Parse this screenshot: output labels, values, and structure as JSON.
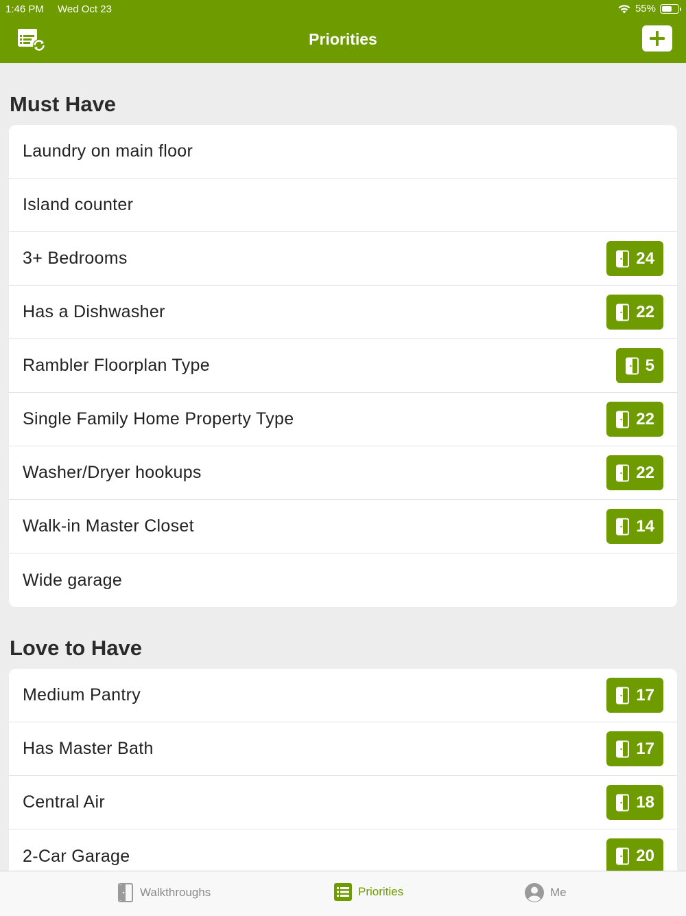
{
  "status_bar": {
    "time": "1:46 PM",
    "date": "Wed Oct 23",
    "battery": "55%",
    "battery_level": 0.55,
    "icons": [
      "wifi-icon",
      "battery-icon"
    ]
  },
  "header": {
    "title": "Priorities",
    "left_icon": "list-sync-icon",
    "right_icon": "plus-icon"
  },
  "sections": {
    "must_have": {
      "title": "Must Have",
      "items": [
        {
          "label": "Laundry on main floor",
          "count": ""
        },
        {
          "label": "Island counter",
          "count": ""
        },
        {
          "label": "3+ Bedrooms",
          "count": "24"
        },
        {
          "label": "Has a Dishwasher",
          "count": "22"
        },
        {
          "label": "Rambler Floorplan Type",
          "count": "5"
        },
        {
          "label": "Single Family Home Property Type",
          "count": "22"
        },
        {
          "label": "Washer/Dryer hookups",
          "count": "22"
        },
        {
          "label": "Walk-in Master Closet",
          "count": "14"
        },
        {
          "label": "Wide garage",
          "count": ""
        }
      ]
    },
    "love_to_have": {
      "title": "Love to Have",
      "items": [
        {
          "label": "Medium Pantry",
          "count": "17"
        },
        {
          "label": "Has Master Bath",
          "count": "17"
        },
        {
          "label": "Central Air",
          "count": "18"
        },
        {
          "label": "2-Car Garage",
          "count": "20"
        }
      ]
    }
  },
  "tabbar": {
    "tabs": [
      {
        "label": "Walkthroughs",
        "icon": "door-icon",
        "active": false
      },
      {
        "label": "Priorities",
        "icon": "list-icon",
        "active": true
      },
      {
        "label": "Me",
        "icon": "person-icon",
        "active": false
      }
    ]
  },
  "colors": {
    "accent": "#6e9b00",
    "background": "#ededed",
    "card": "#ffffff",
    "inactive": "#8a8a8a"
  }
}
